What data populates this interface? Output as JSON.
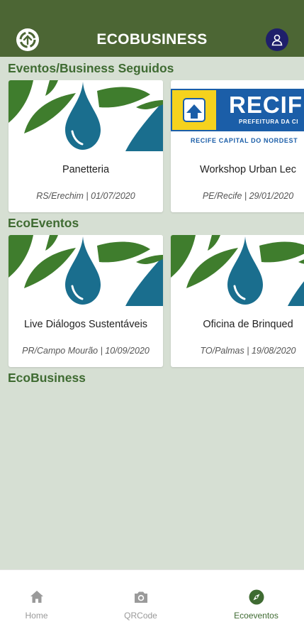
{
  "appbar": {
    "title": "ECOBUSINESS",
    "logo_icon": "recycle-logo-icon",
    "account_icon": "account-icon",
    "color": "#4c6634"
  },
  "sections": {
    "followed": {
      "title": "Eventos/Business Seguidos",
      "cards": [
        {
          "name": "Panetteria",
          "meta": "RS/Erechim | 01/07/2020",
          "image": "eco-drop-leaves"
        },
        {
          "name": "Workshop Urban Lec",
          "meta": "PE/Recife | 29/01/2020",
          "image": "recife-banner",
          "banner_title": "RECIF",
          "banner_sub": "PREFEITURA DA CI",
          "banner_bottom": "RECIFE  CAPITAL DO NORDEST"
        }
      ]
    },
    "ecoeventos": {
      "title": "EcoEventos",
      "cards": [
        {
          "name": "Live Diálogos Sustentáveis",
          "meta": "PR/Campo Mourão | 10/09/2020",
          "image": "eco-drop-leaves"
        },
        {
          "name": "Oficina de Brinqued",
          "meta": "TO/Palmas | 19/08/2020",
          "image": "eco-drop-leaves"
        }
      ]
    },
    "ecobusiness": {
      "title": "EcoBusiness"
    }
  },
  "navbar": {
    "items": [
      {
        "label": "Home",
        "icon": "home-icon",
        "active": false
      },
      {
        "label": "QRCode",
        "icon": "camera-icon",
        "active": false
      },
      {
        "label": "Ecoeventos",
        "icon": "compass-icon",
        "active": true
      }
    ]
  },
  "colors": {
    "primary": "#4c6634",
    "accent": "#3f6b32",
    "background": "#d6dfd3",
    "drop": "#1a6e8e",
    "leaf": "#3f7d2d"
  }
}
